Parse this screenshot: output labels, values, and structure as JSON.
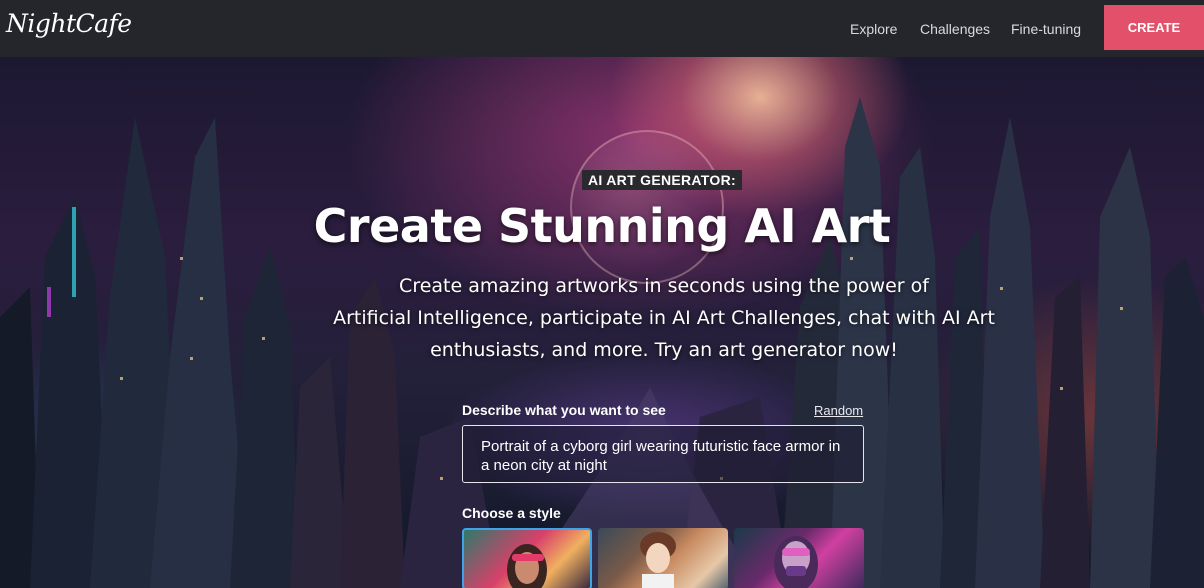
{
  "header": {
    "logo": "NightCafe",
    "nav": [
      {
        "label": "Explore"
      },
      {
        "label": "Challenges"
      },
      {
        "label": "Fine-tuning"
      }
    ],
    "create_label": "CREATE",
    "create_color": "#e2506a"
  },
  "hero": {
    "kicker": "AI ART GENERATOR:",
    "title": "Create Stunning AI Art",
    "subtitle_lines": [
      "Create amazing artworks in seconds using the power of",
      "Artificial Intelligence, participate in AI Art Challenges, chat with AI Art",
      "enthusiasts, and more. Try an art generator now!"
    ],
    "prompt": {
      "label": "Describe what you want to see",
      "random_label": "Random",
      "value": "Portrait of a cyborg girl wearing futuristic face armor in a neon city at night"
    },
    "style": {
      "label": "Choose a style",
      "thumbnails": [
        {
          "icon": "style-thumbnail-cyberpunk-girl",
          "selected": true
        },
        {
          "icon": "style-thumbnail-anime-boy",
          "selected": false
        },
        {
          "icon": "style-thumbnail-neon-mask",
          "selected": false
        }
      ]
    }
  }
}
